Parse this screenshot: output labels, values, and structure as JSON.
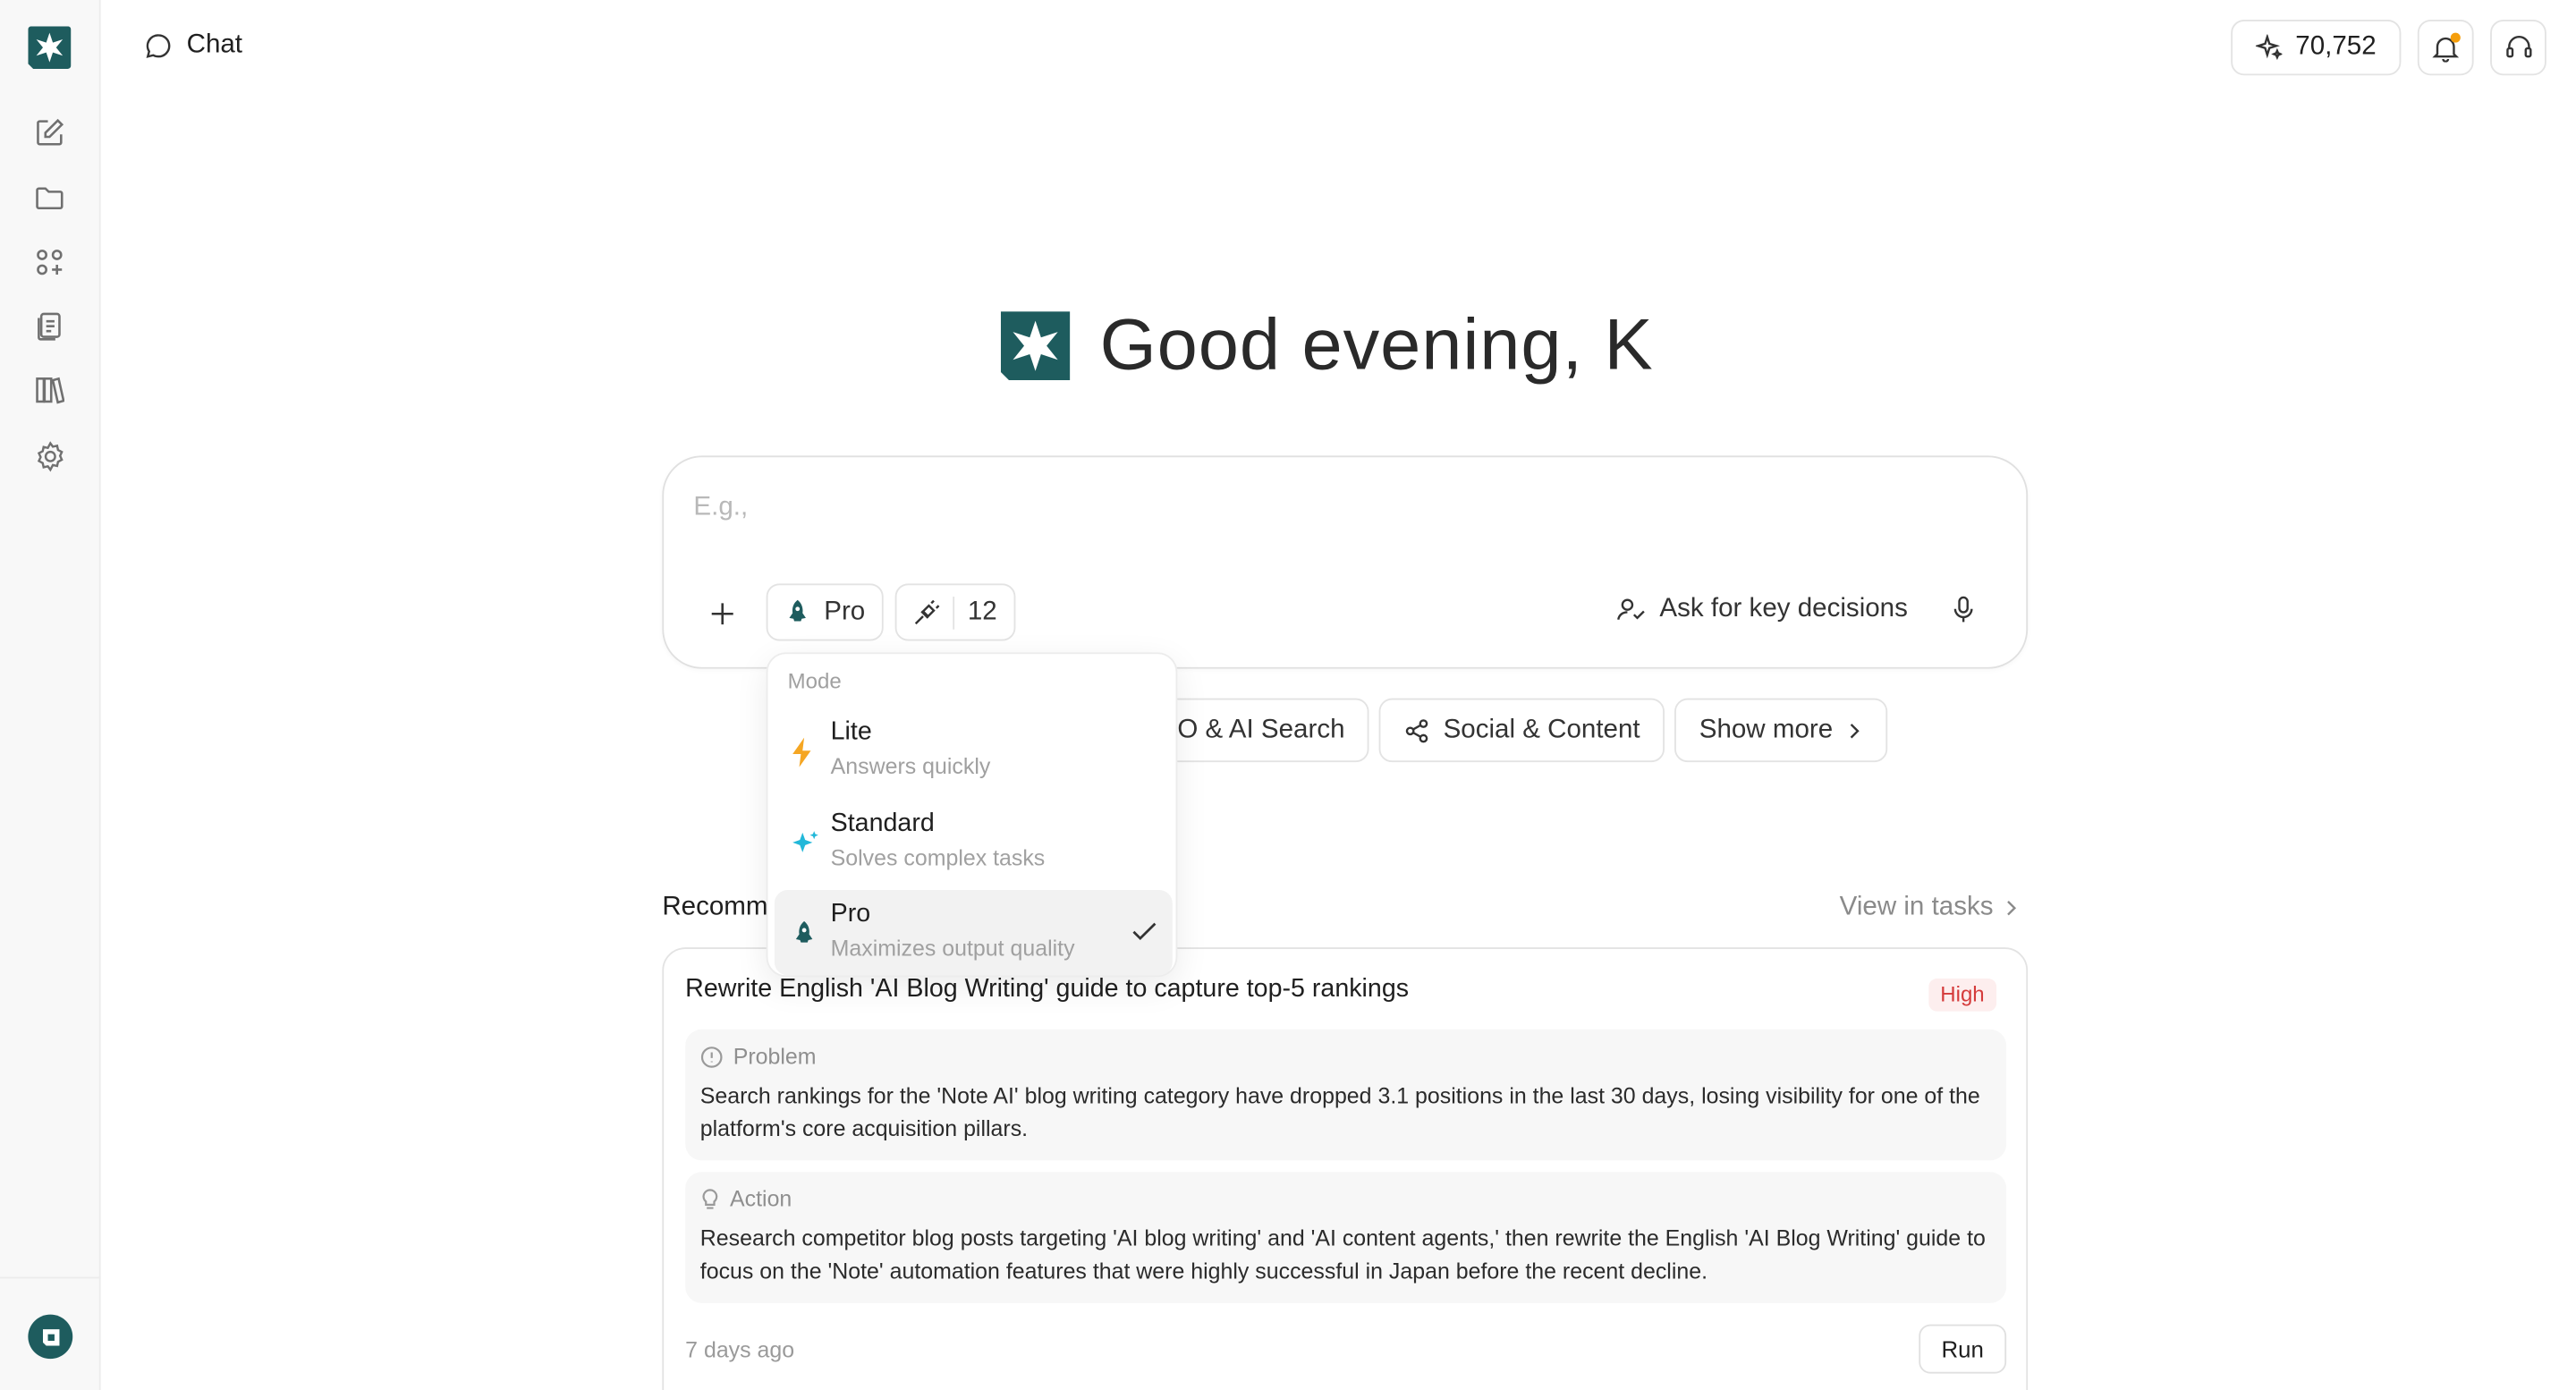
{
  "header": {
    "title": "Chat",
    "credits": "70,752"
  },
  "greeting": "Good evening, K",
  "composer": {
    "placeholder": "E.g.,",
    "mode_label": "Pro",
    "tools_count": "12",
    "ask_key_decisions": "Ask for key decisions"
  },
  "chips": [
    {
      "label": "O & AI Search"
    },
    {
      "label": "Social & Content"
    },
    {
      "label": "Show more"
    }
  ],
  "mode_menu": {
    "heading": "Mode",
    "items": [
      {
        "name": "Lite",
        "desc": "Answers quickly",
        "icon": "lightning-icon",
        "color": "#f5a623"
      },
      {
        "name": "Standard",
        "desc": "Solves complex tasks",
        "icon": "sparkle-icon",
        "color": "#22b8d9"
      },
      {
        "name": "Pro",
        "desc": "Maximizes output quality",
        "icon": "rocket-icon",
        "color": "#1e5c5e",
        "selected": true
      }
    ]
  },
  "recommended": {
    "heading": "Recomm",
    "view_link": "View in tasks",
    "card": {
      "title": "Rewrite English 'AI Blog Writing' guide to capture top-5 rankings",
      "priority": "High",
      "problem_label": "Problem",
      "problem_text": "Search rankings for the 'Note AI' blog writing category have dropped 3.1 positions in the last 30 days, losing visibility for one of the platform's core acquisition pillars.",
      "action_label": "Action",
      "action_text": "Research competitor blog posts targeting 'AI blog writing' and 'AI content agents,' then rewrite the English 'AI Blog Writing' guide to focus on the 'Note' automation features that were highly successful in Japan before the recent decline.",
      "age": "7 days ago",
      "run_label": "Run"
    }
  },
  "colors": {
    "brand": "#1e5c5e",
    "notification_dot": "#f59e0b",
    "high_priority": "#d53b3b"
  }
}
